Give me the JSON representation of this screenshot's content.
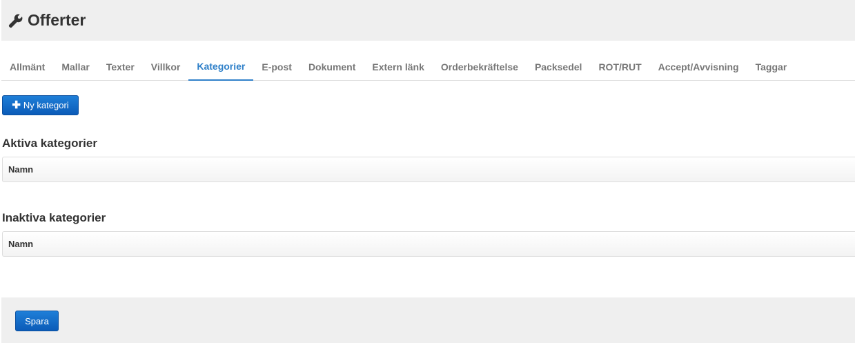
{
  "header": {
    "icon": "wrench-icon",
    "title": "Offerter"
  },
  "tabs": [
    {
      "label": "Allmänt",
      "active": false
    },
    {
      "label": "Mallar",
      "active": false
    },
    {
      "label": "Texter",
      "active": false
    },
    {
      "label": "Villkor",
      "active": false
    },
    {
      "label": "Kategorier",
      "active": true
    },
    {
      "label": "E-post",
      "active": false
    },
    {
      "label": "Dokument",
      "active": false
    },
    {
      "label": "Extern länk",
      "active": false
    },
    {
      "label": "Orderbekräftelse",
      "active": false
    },
    {
      "label": "Packsedel",
      "active": false
    },
    {
      "label": "ROT/RUT",
      "active": false
    },
    {
      "label": "Accept/Avvisning",
      "active": false
    },
    {
      "label": "Taggar",
      "active": false
    }
  ],
  "toolbar": {
    "new_category_icon": "plus-icon",
    "new_category_label": "Ny kategori"
  },
  "active_section": {
    "title": "Aktiva kategorier",
    "columns": [
      "Namn"
    ],
    "rows": []
  },
  "inactive_section": {
    "title": "Inaktiva kategorier",
    "columns": [
      "Namn"
    ],
    "rows": []
  },
  "footer": {
    "save_label": "Spara"
  },
  "colors": {
    "accent": "#2f80c9",
    "button": "#0b5bb8",
    "panel": "#efefef"
  }
}
